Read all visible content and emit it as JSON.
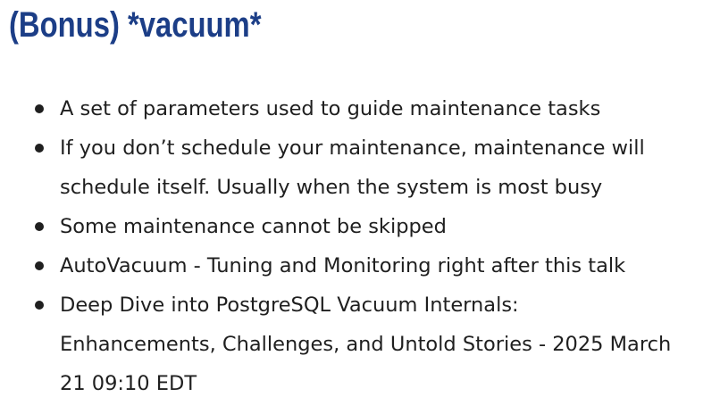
{
  "slide": {
    "title": "(Bonus) *vacuum*",
    "bullets": [
      {
        "lines": [
          "A set of parameters used to guide maintenance tasks"
        ]
      },
      {
        "lines": [
          "If you don’t schedule your maintenance, maintenance will",
          "schedule itself. Usually when the system is most busy"
        ]
      },
      {
        "lines": [
          "Some maintenance cannot be skipped"
        ]
      },
      {
        "lines": [
          "AutoVacuum - Tuning and Monitoring right after this talk"
        ]
      },
      {
        "lines": [
          "Deep Dive into PostgreSQL Vacuum Internals:",
          "Enhancements, Challenges, and Untold Stories - 2025 March",
          "21 09:10 EDT"
        ]
      }
    ]
  },
  "colors": {
    "title": "#1c3e87",
    "text": "#1f1f1f",
    "background": "#ffffff"
  }
}
